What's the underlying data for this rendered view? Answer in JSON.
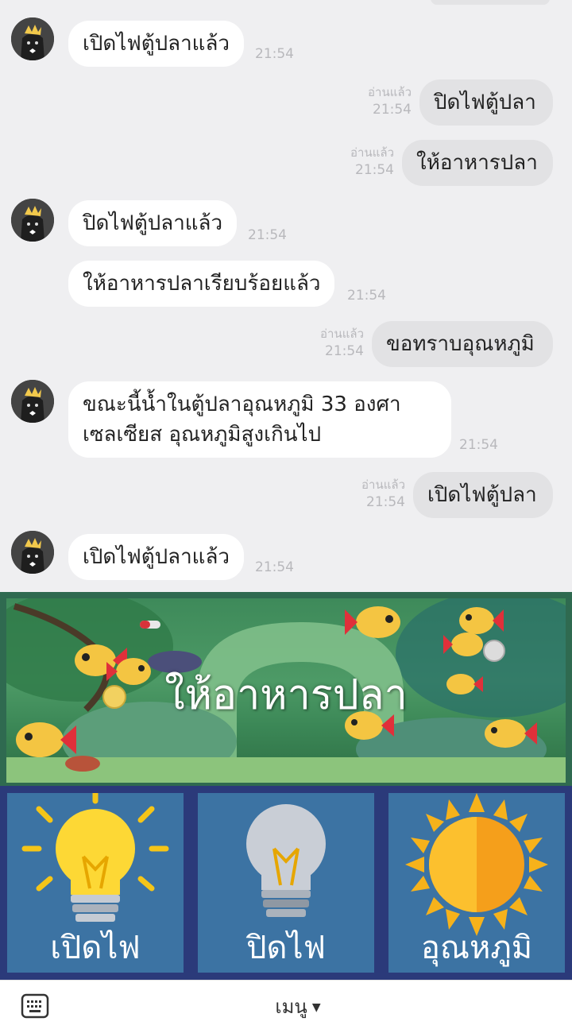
{
  "chat": {
    "messages": [
      {
        "direction": "in",
        "lines": [
          "เปิดไฟตู้ปลาแล้ว"
        ],
        "time": "21:54"
      },
      {
        "direction": "out",
        "lines": [
          "ปิดไฟตู้ปลา"
        ],
        "read": "อ่านแล้ว",
        "time": "21:54"
      },
      {
        "direction": "out",
        "lines": [
          "ให้อาหารปลา"
        ],
        "read": "อ่านแล้ว",
        "time": "21:54"
      },
      {
        "direction": "in",
        "lines": [
          "ปิดไฟตู้ปลาแล้ว"
        ],
        "time": "21:54"
      },
      {
        "direction": "in",
        "lines": [
          "ให้อาหารปลาเรียบร้อยแล้ว"
        ],
        "time": "21:54"
      },
      {
        "direction": "out",
        "lines": [
          "ขอทราบอุณหภูมิ"
        ],
        "read": "อ่านแล้ว",
        "time": "21:54"
      },
      {
        "direction": "in",
        "lines": [
          "ขณะนี้น้ำในตู้ปลาอุณหภูมิ 33 องศา",
          "เซลเซียส อุณหภูมิสูงเกินไป"
        ],
        "time": "21:54"
      },
      {
        "direction": "out",
        "lines": [
          "เปิดไฟตู้ปลา"
        ],
        "read": "อ่านแล้ว",
        "time": "21:54"
      },
      {
        "direction": "in",
        "lines": [
          "เปิดไฟตู้ปลาแล้ว"
        ],
        "time": "21:54"
      }
    ]
  },
  "rich_menu": {
    "banner": {
      "label": "ให้อาหารปลา"
    },
    "buttons": [
      {
        "label": "เปิดไฟ",
        "icon": "lightbulb-on-icon"
      },
      {
        "label": "ปิดไฟ",
        "icon": "lightbulb-off-icon"
      },
      {
        "label": "อุณหภูมิ",
        "icon": "sun-icon"
      }
    ]
  },
  "bottom_bar": {
    "menu_label": "เมนู",
    "caret": "▼",
    "keyboard_icon": "keyboard-icon"
  },
  "colors": {
    "chat_bg": "#efeff1",
    "incoming_bubble": "#ffffff",
    "outgoing_bubble": "#e2e2e4",
    "tile_bg": "#3c73a3",
    "menu_frame": "#2b3a7a"
  }
}
